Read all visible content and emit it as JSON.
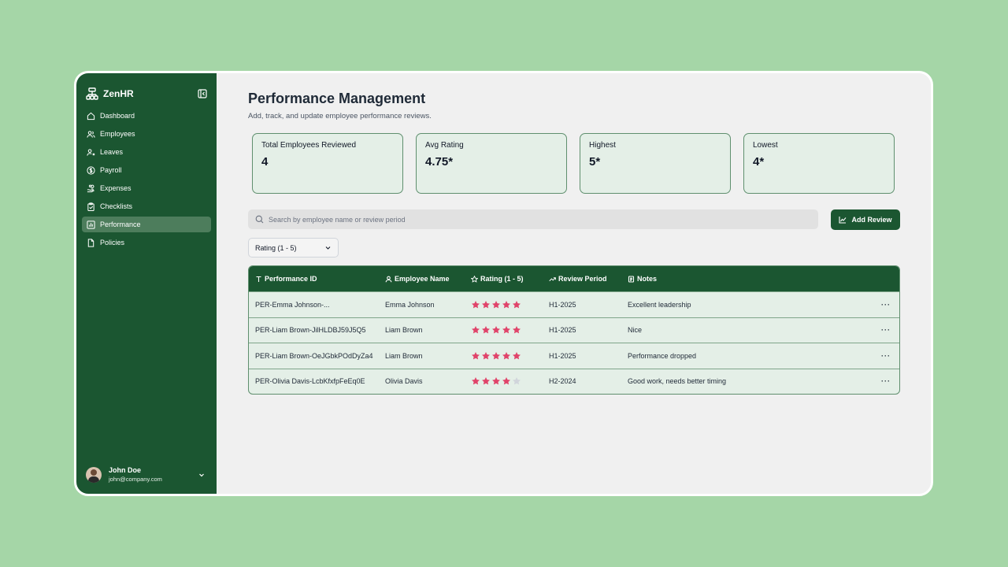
{
  "app": {
    "name": "ZenHR"
  },
  "sidebar": {
    "items": [
      {
        "label": "Dashboard",
        "icon": "home-icon"
      },
      {
        "label": "Employees",
        "icon": "users-icon"
      },
      {
        "label": "Leaves",
        "icon": "user-x-icon"
      },
      {
        "label": "Payroll",
        "icon": "dollar-icon"
      },
      {
        "label": "Expenses",
        "icon": "hand-coins-icon"
      },
      {
        "label": "Checklists",
        "icon": "clipboard-check-icon"
      },
      {
        "label": "Performance",
        "icon": "bar-chart-icon",
        "active": true
      },
      {
        "label": "Policies",
        "icon": "file-icon"
      }
    ],
    "user": {
      "name": "John Doe",
      "email": "john@company.com"
    }
  },
  "page": {
    "title": "Performance Management",
    "subtitle": "Add, track, and update employee performance reviews."
  },
  "stats": [
    {
      "label": "Total Employees Reviewed",
      "value": "4"
    },
    {
      "label": "Avg Rating",
      "value": "4.75*"
    },
    {
      "label": "Highest",
      "value": "5*"
    },
    {
      "label": "Lowest",
      "value": "4*"
    }
  ],
  "search": {
    "placeholder": "Search by employee name or review period",
    "value": ""
  },
  "add_button": {
    "label": "Add Review"
  },
  "filter": {
    "label": "Rating (1 - 5)"
  },
  "table": {
    "headers": [
      "Performance ID",
      "Employee Name",
      "Rating (1 - 5)",
      "Review Period",
      "Notes"
    ],
    "rows": [
      {
        "id": "PER-Emma Johnson-...",
        "name": "Emma Johnson",
        "rating": 5,
        "period": "H1-2025",
        "notes": "Excellent leadership",
        "action": "···"
      },
      {
        "id": "PER-Liam Brown-JilHLDBJ59J5Q5",
        "name": "Liam Brown",
        "rating": 5,
        "period": "H1-2025",
        "notes": "Nice",
        "action": "···"
      },
      {
        "id": "PER-Liam Brown-OeJGbkPOdDyZa4",
        "name": "Liam Brown",
        "rating": 5,
        "period": "H1-2025",
        "notes": "Performance dropped",
        "action": "···"
      },
      {
        "id": "PER-Olivia Davis-LcbKfxfpFeEq0E",
        "name": "Olivia Davis",
        "rating": 4,
        "period": "H2-2024",
        "notes": "Good work, needs better timing",
        "action": "···"
      }
    ]
  },
  "colors": {
    "background": "#a5d6a7",
    "sidebar": "#1b5631",
    "star_filled": "#e0446a",
    "star_empty": "#d1d5db"
  }
}
